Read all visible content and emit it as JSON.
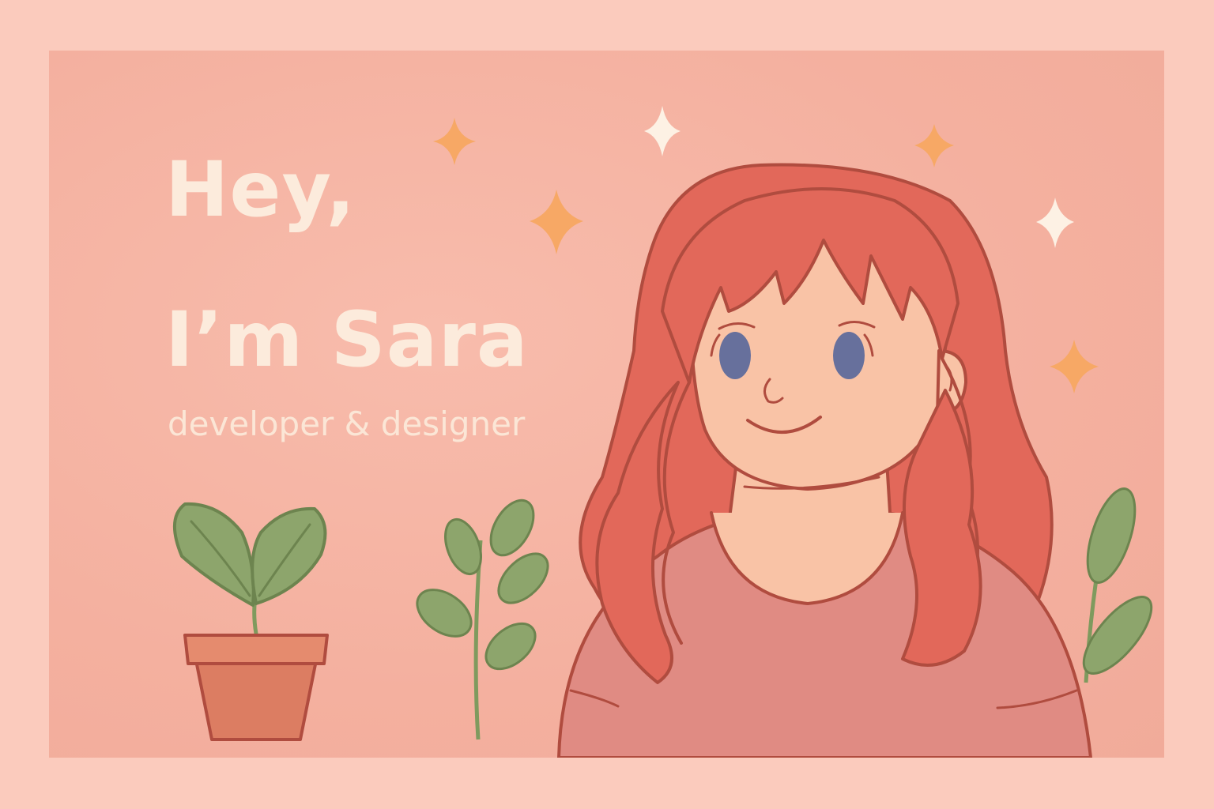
{
  "hero": {
    "heading_line1": "Hey,",
    "heading_line2": "I’m Sara",
    "tagline": "developer & designer"
  },
  "colors": {
    "page_background": "#fbcbbd",
    "card_background": "#f6b3a3",
    "heading_text": "#fcebdc",
    "hair": "#e2685a",
    "outline": "#b04c3f",
    "skin": "#f9c3a6",
    "shirt": "#e08b83",
    "eyes": "#67709c",
    "leaf": "#8da56c",
    "pot": "#dc7d62",
    "sparkle_orange": "#f7a865",
    "sparkle_white": "#fdf1e4"
  },
  "icons": [
    "sparkle-icon",
    "plant-pot-icon",
    "leaf-sprig-icon",
    "avatar-illustration"
  ]
}
